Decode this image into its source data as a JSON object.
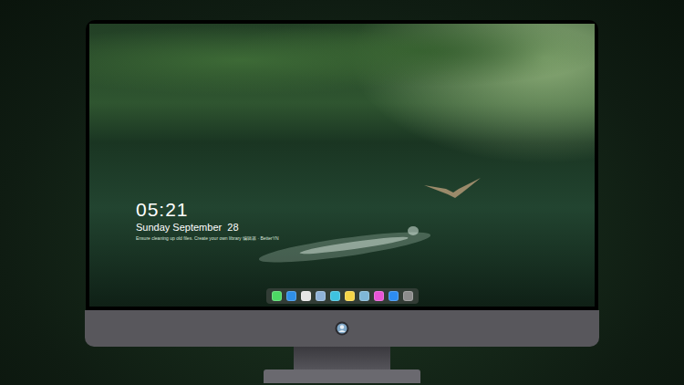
{
  "lock_screen": {
    "time": "05:21",
    "date": "Sunday September  28",
    "tagline": "Ensure cleaning up old files. Create your own library 编辑器 · BetterYN"
  },
  "dock": {
    "apps": [
      {
        "color": "#4cd964"
      },
      {
        "color": "#2f8fe8"
      },
      {
        "color": "#e6e6e6"
      },
      {
        "color": "#8fb3d9"
      },
      {
        "color": "#3ec3e0"
      },
      {
        "color": "#f5d547"
      },
      {
        "color": "#7fb7d8"
      },
      {
        "color": "#e854d6"
      },
      {
        "color": "#2d8cf0"
      },
      {
        "color": "#8c8c8c"
      }
    ]
  }
}
